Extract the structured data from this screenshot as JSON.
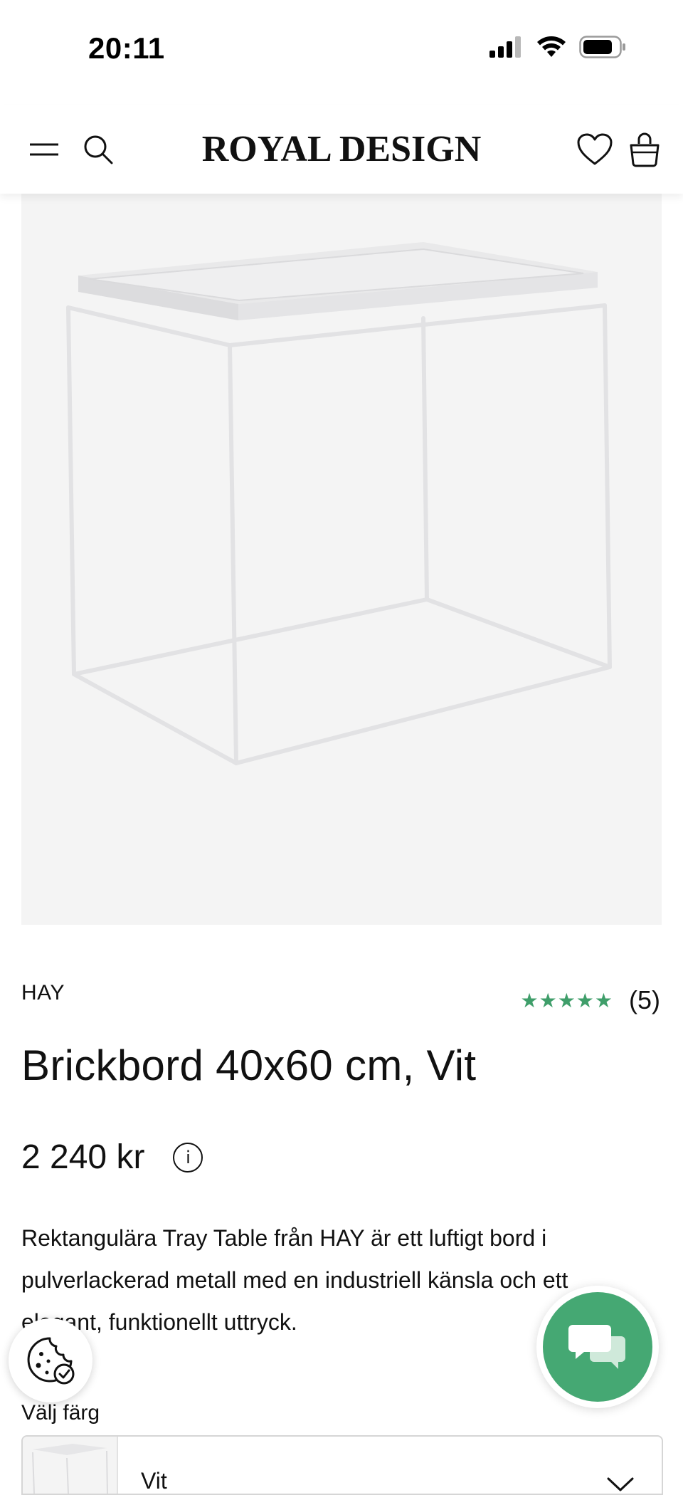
{
  "status_bar": {
    "time": "20:11",
    "icons": [
      "signal-icon",
      "wifi-icon",
      "battery-icon"
    ]
  },
  "header": {
    "brand": "ROYAL DESIGN",
    "icons": [
      "menu-icon",
      "search-icon",
      "heart-icon",
      "bag-icon"
    ]
  },
  "product": {
    "brand": "HAY",
    "rating": {
      "stars": "★★★★★",
      "value": 5,
      "count_label": "(5)"
    },
    "title": "Brickbord 40x60 cm, Vit",
    "price": "2 240 kr",
    "info_icon_label": "i",
    "description": "Rektangulära Tray Table från HAY är ett luftigt bord i pulverlackerad metall med en industriell känsla och ett elegant, funktionellt uttryck."
  },
  "color_selector": {
    "label": "Välj färg",
    "selected": "Vit"
  },
  "floating": {
    "cookie_icon": "cookie-settings-icon",
    "chat_icon": "chat-icon"
  },
  "colors": {
    "accent_green": "#45a873",
    "star_green": "#3f9e6a",
    "image_bg": "#f4f4f4"
  }
}
